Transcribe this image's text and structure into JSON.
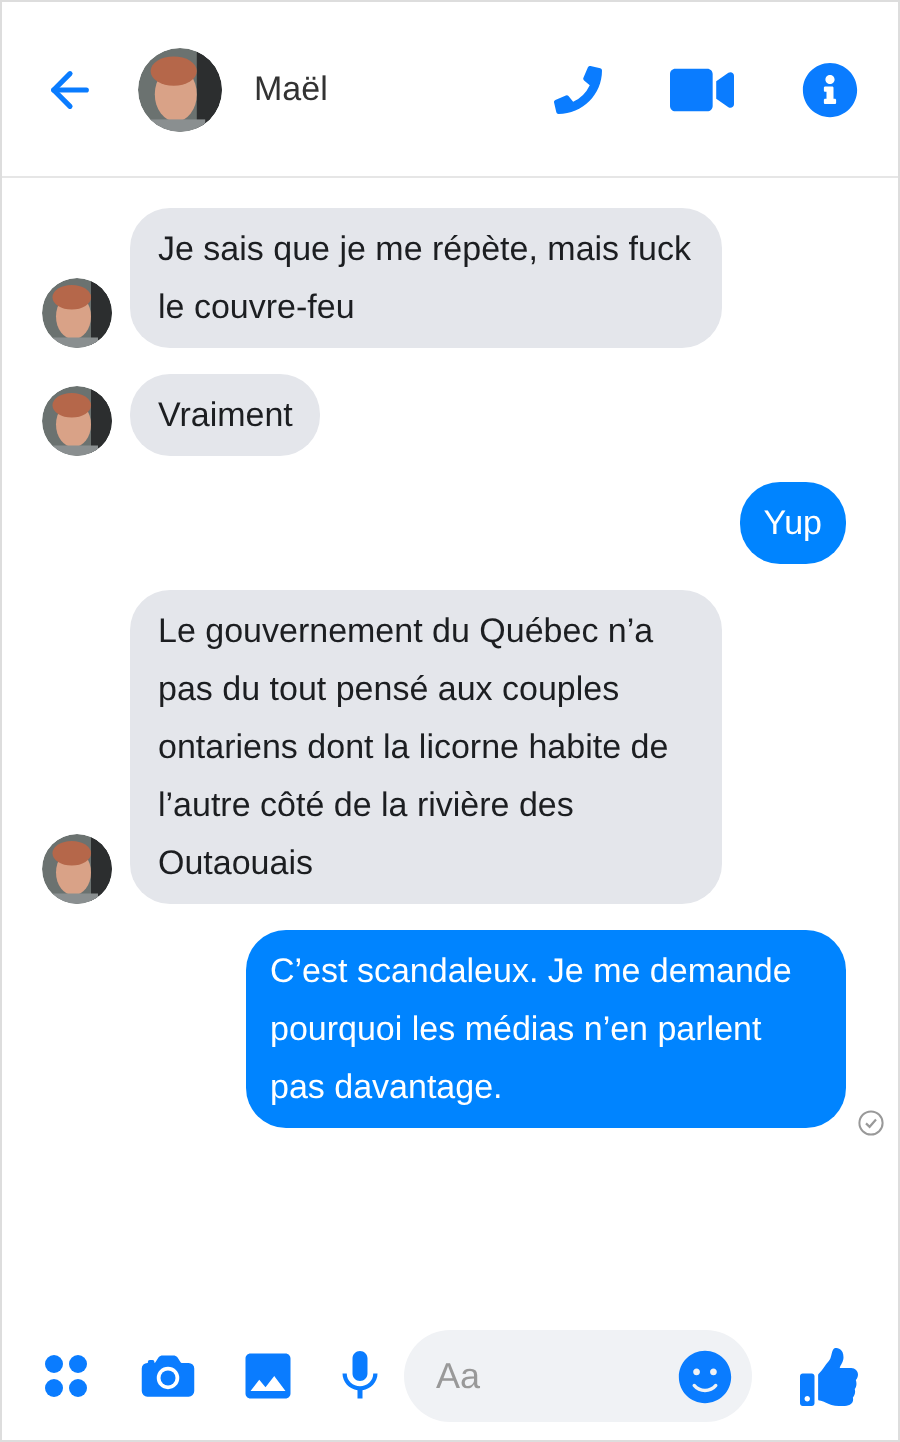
{
  "header": {
    "name": "Maël"
  },
  "messages": [
    {
      "kind": "incoming",
      "text": "Je sais que je me répète, mais fuck le couvre-feu"
    },
    {
      "kind": "incoming",
      "text": "Vraiment"
    },
    {
      "kind": "outgoing",
      "text": "Yup",
      "receipt": false
    },
    {
      "kind": "incoming",
      "text": "Le gouvernement du Québec n’a pas du tout pensé aux couples ontariens dont la licorne habite de l’autre côté de la rivière des Outaouais"
    },
    {
      "kind": "outgoing",
      "text": "C’est scandaleux. Je me demande pourquoi les médias n’en parlent pas davantage.",
      "receipt": true
    }
  ],
  "composer": {
    "placeholder": "Aa"
  }
}
